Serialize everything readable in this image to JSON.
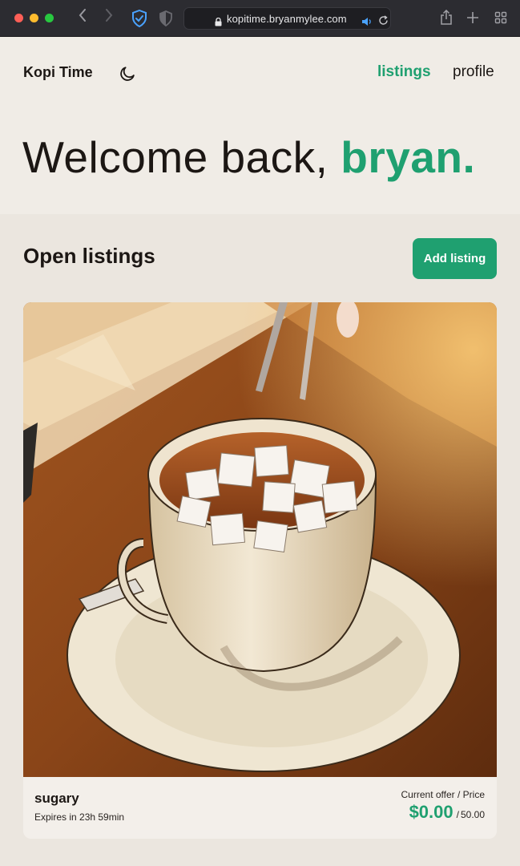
{
  "browser": {
    "url": "kopitime.bryanmylee.com",
    "icons": {
      "back": "chevron-left-icon",
      "forward": "chevron-right-icon",
      "privacy": "shield-check-icon",
      "reader": "shield-icon",
      "lock": "lock-icon",
      "audio": "speaker-icon",
      "reload": "reload-icon",
      "share": "share-icon",
      "new_tab": "plus-icon",
      "tabs": "tab-overview-icon"
    }
  },
  "header": {
    "brand": "Kopi Time",
    "theme_toggle_icon": "moon-icon",
    "nav": {
      "listings": "listings",
      "profile": "profile"
    }
  },
  "welcome": {
    "prefix": "Welcome back, ",
    "name": "bryan."
  },
  "listings_section": {
    "title": "Open listings",
    "add_button": "Add listing",
    "items": [
      {
        "name": "sugary",
        "expiry": "Expires in 23h 59min",
        "offer_label": "Current offer / Price",
        "current_offer": "$0.00",
        "separator": "/",
        "price": "50.00",
        "image": "anime-style cup of tea with sugar cubes on saucer"
      }
    ]
  },
  "colors": {
    "accent": "#1fa070",
    "text": "#1c1714",
    "background": "#efebe5"
  }
}
